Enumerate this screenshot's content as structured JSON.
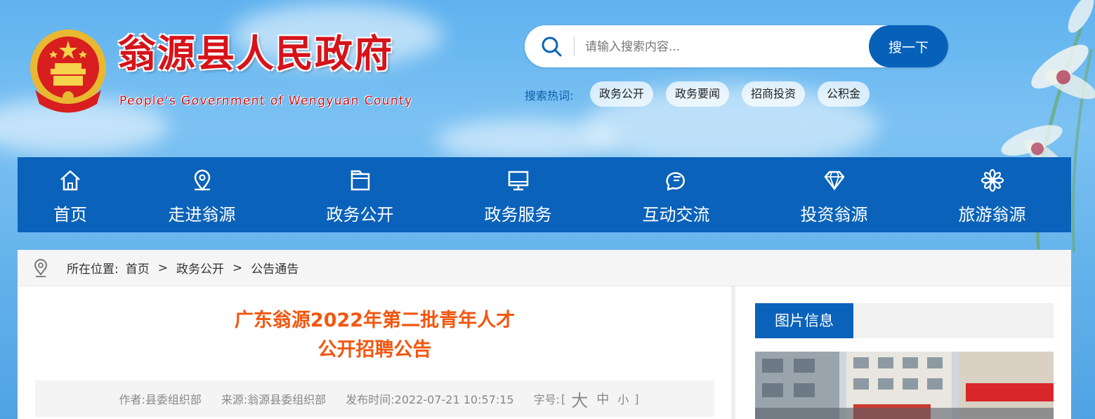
{
  "header": {
    "title": "翁源县人民政府",
    "subtitle": "People's Government of Wengyuan County"
  },
  "search": {
    "placeholder": "请输入搜索内容...",
    "button_label": "搜一下",
    "hot_label": "搜索热词:",
    "hot_tags": [
      "政务公开",
      "政务要闻",
      "招商投资",
      "公积金"
    ]
  },
  "nav": {
    "items": [
      {
        "label": "首页",
        "icon": "home-icon"
      },
      {
        "label": "走进翁源",
        "icon": "location-pin-icon"
      },
      {
        "label": "政务公开",
        "icon": "folder-icon"
      },
      {
        "label": "政务服务",
        "icon": "monitor-icon"
      },
      {
        "label": "互动交流",
        "icon": "chat-bubble-icon"
      },
      {
        "label": "投资翁源",
        "icon": "diamond-icon"
      },
      {
        "label": "旅游翁源",
        "icon": "flower-icon"
      }
    ]
  },
  "breadcrumb": {
    "prefix": "所在位置:",
    "items": [
      "首页",
      "政务公开",
      "公告通告"
    ],
    "separator": ">"
  },
  "article": {
    "title_line1": "广东翁源2022年第二批青年人才",
    "title_line2": "公开招聘公告",
    "author": "作者:县委组织部",
    "source": "来源:翁源县委组织部",
    "published": "发布时间:2022-07-21 10:57:15",
    "font_size_label": "字号:",
    "bracket_open": "[",
    "bracket_close": "]",
    "font_size_large": "大",
    "font_size_medium": "中",
    "font_size_small": "小"
  },
  "sidebar": {
    "section_title": "图片信息"
  },
  "colors": {
    "brand_blue": "#0a62ba",
    "title_orange": "#f2560f",
    "site_red": "#d6131a"
  }
}
